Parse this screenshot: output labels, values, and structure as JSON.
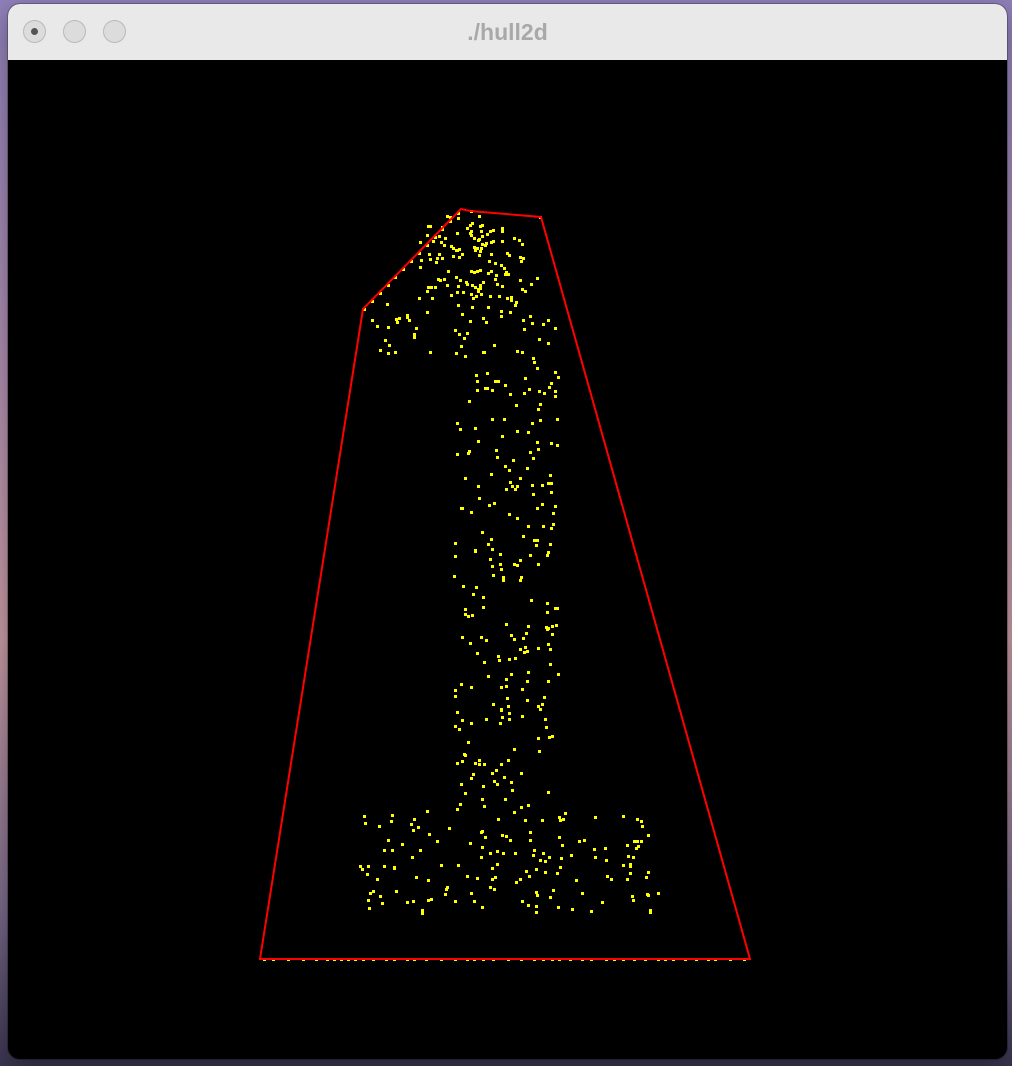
{
  "window": {
    "title": "./hull2d",
    "buttons": [
      "close",
      "minimize",
      "maximize"
    ]
  },
  "scene": {
    "background": "#000000",
    "point_color": "#ffff00",
    "hull_color": "#ff0000",
    "description_shape": "digit-1 point cloud with convex hull"
  }
}
